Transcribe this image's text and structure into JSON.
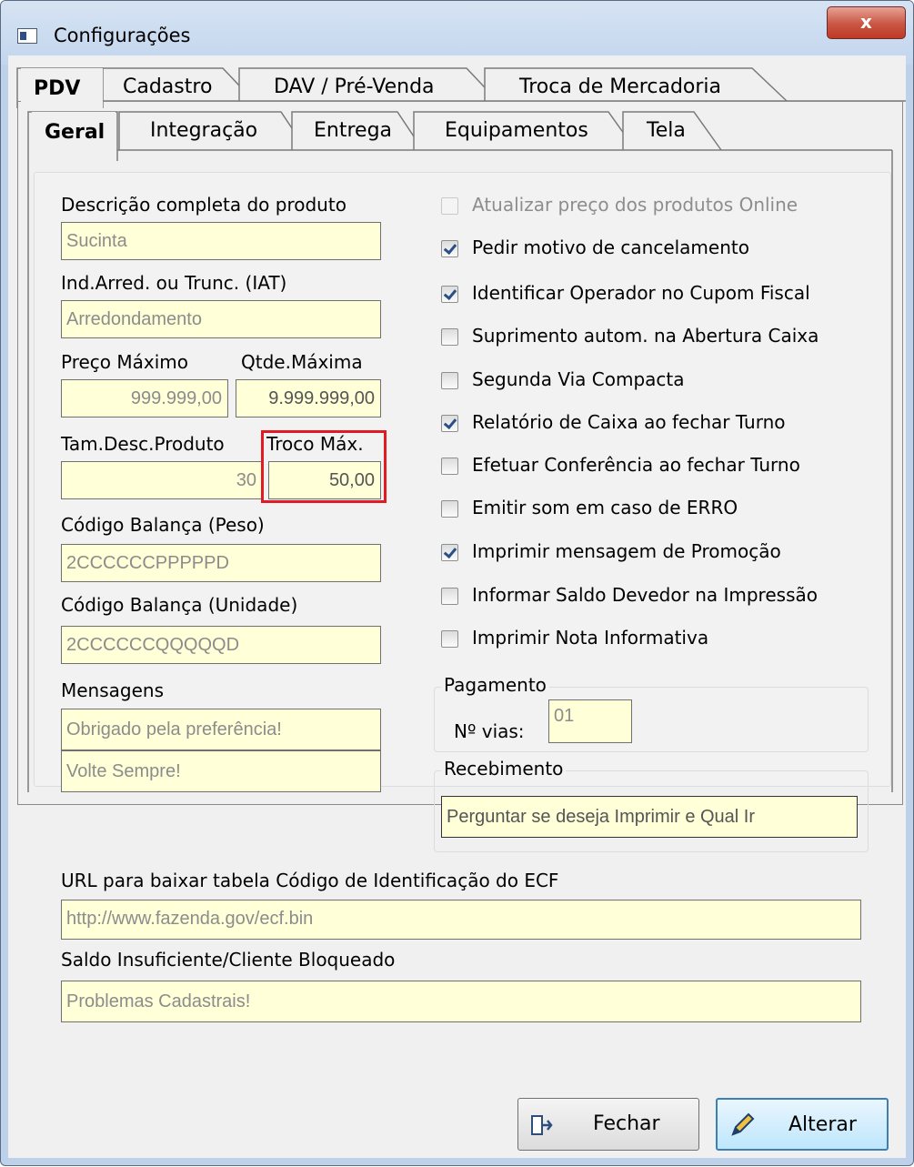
{
  "window": {
    "title": "Configurações",
    "close_label": "x"
  },
  "top_tabs": [
    "PDV",
    "Cadastro",
    "DAV / Pré-Venda",
    "Troca de Mercadoria"
  ],
  "sub_tabs": [
    "Geral",
    "Integração",
    "Entrega",
    "Equipamentos",
    "Tela"
  ],
  "left": {
    "descricao_label": "Descrição completa do produto",
    "descricao_value": "Sucinta",
    "ind_label": "Ind.Arred. ou Trunc. (IAT)",
    "ind_value": "Arredondamento",
    "preco_label": "Preço Máximo",
    "preco_value": "999.999,00",
    "qtde_label": "Qtde.Máxima",
    "qtde_value": "9.999.999,00",
    "tam_label": "Tam.Desc.Produto",
    "tam_value": "30",
    "troco_label": "Troco Máx.",
    "troco_value": "50,00",
    "balanca_peso_label": "Código Balança (Peso)",
    "balanca_peso_value": "2CCCCCCPPPPPD",
    "balanca_unid_label": "Código Balança (Unidade)",
    "balanca_unid_value": "2CCCCCCQQQQQD",
    "mensagens_label": "Mensagens",
    "mensagem1": "Obrigado pela preferência!",
    "mensagem2": "Volte Sempre!"
  },
  "checkboxes": [
    {
      "label": "Atualizar preço dos produtos Online",
      "checked": false,
      "disabled": true
    },
    {
      "label": "Pedir motivo de cancelamento",
      "checked": true,
      "disabled": false
    },
    {
      "label": "Identificar Operador no Cupom Fiscal",
      "checked": true,
      "disabled": false
    },
    {
      "label": "Suprimento autom. na Abertura Caixa",
      "checked": false,
      "disabled": false
    },
    {
      "label": "Segunda Via Compacta",
      "checked": false,
      "disabled": false
    },
    {
      "label": "Relatório de Caixa ao fechar Turno",
      "checked": true,
      "disabled": false
    },
    {
      "label": "Efetuar Conferência ao fechar Turno",
      "checked": false,
      "disabled": false
    },
    {
      "label": "Emitir som em caso de ERRO",
      "checked": false,
      "disabled": false
    },
    {
      "label": "Imprimir mensagem de Promoção",
      "checked": true,
      "disabled": false
    },
    {
      "label": "Informar Saldo Devedor na Impressão",
      "checked": false,
      "disabled": false
    },
    {
      "label": "Imprimir Nota Informativa",
      "checked": false,
      "disabled": false
    }
  ],
  "pagamento": {
    "title": "Pagamento",
    "vias_label": "Nº vias:",
    "vias_value": "01"
  },
  "recebimento": {
    "title": "Recebimento",
    "value": "Perguntar se deseja Imprimir e Qual Ir"
  },
  "url": {
    "label": "URL para baixar tabela Código de Identificação do ECF",
    "value": "http://www.fazenda.gov/ecf.bin"
  },
  "saldo": {
    "label": "Saldo Insuficiente/Cliente Bloqueado",
    "value": "Problemas Cadastrais!"
  },
  "buttons": {
    "fechar": "Fechar",
    "alterar": "Alterar"
  },
  "colors": {
    "field_bg": "#ffffd8",
    "highlight": "#e01b24",
    "title_bar": "#c3d6ee"
  }
}
